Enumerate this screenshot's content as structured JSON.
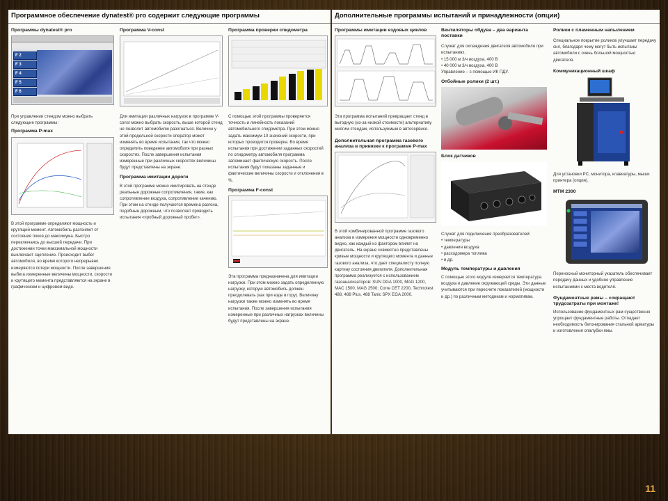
{
  "left": {
    "header": "Программное обеспечение dynatest® pro содержит следующие программы",
    "col1": {
      "title1": "Программы dynatest® pro",
      "keys": [
        "F 2",
        "F 3",
        "F 4",
        "F 5",
        "F 6"
      ],
      "text1": "При управлении стендом можно выбрать следующие программы:",
      "title2": "Программа P-max",
      "text2": "В этой программе определяют мощность и крутящий момент. Автомобиль разгоняют от состояния покоя до максимума. Быстро переключаясь до высшей передачи. При достижении точки максимальной мощности выключают сцепление. Происходит выбег автомобиля, во время которого непрерывно измеряются потери мощности. После завершения выбега измеренные величины мощности, скорости и крутящего момента представляются на экране в графическом и цифровом виде."
    },
    "col2": {
      "title1": "Программа V-const",
      "text1": "Для имитации различных нагрузок в программе V-const можно выбрать скорость, выше которой стенд не позволит автомобилю разогнаться. Величин у этой предельной скорости оператор может изменять во время испытания, так что можно определить поведение автомобиля при разных скоростях. После завершения испытания измеренные при различных скоростях величины будут представлены на экране.",
      "title2": "Программа имитации дороги",
      "text2": "В этой программе можно имитировать на стенде реальные дорожные сопротивления, такие, как сопротивление воздуха, сопротивление качению. При этом на стенде получаются времена разгона, подобные дорожным, что позволяет проводить испытания «пробный дорожный пробег»."
    },
    "col3": {
      "title1": "Программа проверки спидометра",
      "text1": "С помощью этой программы проверяется точность и линейность показаний автомобильного спидометра. При этом можно задать максимум 10 значений скорости, при которых проводится проверка. Во время испытания при достижении заданных скоростей по спидометру автомобиля программа запоминает фактическую скорость. После испытания будут показаны заданные и фактические величины скорости и отклонения в %.",
      "title2": "Программа F-const",
      "text2": "Эта программа предназначена для имитации нагрузки. При этом можно задать определенную нагрузку, которую автомобиль должен преодолевать (как при езде в гору). Величину нагрузки также можно изменять во время испытания. После завершения испытания измеренные при различных нагрузках величины будут представлены на экране."
    }
  },
  "right": {
    "header": "Дополнительные программы испытаний и принадлежности (опции)",
    "col1": {
      "title1": "Программы имитации ездовых циклов",
      "text1": "Эта программа испытаний превращает стенд в выгодную (из-за низкой стоимости) альтернативу многим стендам, используемым в автосервисе.",
      "title2": "Дополнительная программа газового анализа в привязке к программе P-max",
      "text2": "В этой комбинированной программе газового анализа и измерения мощности одновременно видно, как каждый из фактором влияет на двигатель. На экране совместно представлены кривые мощности и крутящего момента и данные газового анализа, что дает специалисту полную картину состояния двигателя. Дополнительная программа реализуется с использованием газоанализаторов: SUN DGA 1000, MAG 1200, MAC 1500, MAG 2500; Corre CET 2200, Technotest 488, 488 Plus, 488 Tanic SPX EGA 2000."
    },
    "col2": {
      "title1": "Вентиляторы обдува – два варианта поставки",
      "text1": "Служат для охлаждения двигателя автомобиля при испытаниях.",
      "bullets1": [
        "15 000 м 3/ч воздуха, 400 В",
        "40 000 м 3/ч воздуха, 400 В"
      ],
      "text1b": "Управление – с помощью ИК ПДУ.",
      "title2": "Отбойные ролики (2 шт.)",
      "title3": "Блок датчиков",
      "text3": "Служат для подключения преобразователей:",
      "bullets3": [
        "температуры",
        "давления воздуха",
        "расходомера топлива",
        "и др."
      ],
      "title4": "Модуль температуры и давления",
      "text4": "С помощью этого модуля измеряется температура воздуха и давление окружающей среды. Эти данные учитываются при пересчете показателей (мощности и др.) по различным методикам и нормативам."
    },
    "col3": {
      "title1": "Ролики с пламенным напылением",
      "text1": "Специальное покрытие роликов улучшает передачу сил, благодаря чему могут быть испытаны автомобили с очень большой мощностью двигателя.",
      "title2": "Коммуникационный шкаф",
      "text2": "Для установки PC, монитора, клавиатуры, мыши принтера (опция).",
      "title3": "МТМ 2300",
      "text3": "Переносный мониторный указатель обеспечивает передачу данных и удобное управление испытаниями с места водителя.",
      "title4": "Фундаментные рамы – сокращают трудозатраты при монтаже!",
      "text4": "Использование фундаментных рам существенно упрощает фундаментные работы. Отпадает необходимость бетонирования стальной арматуры и изготовления опалубки ямы."
    }
  },
  "page_number": "11"
}
